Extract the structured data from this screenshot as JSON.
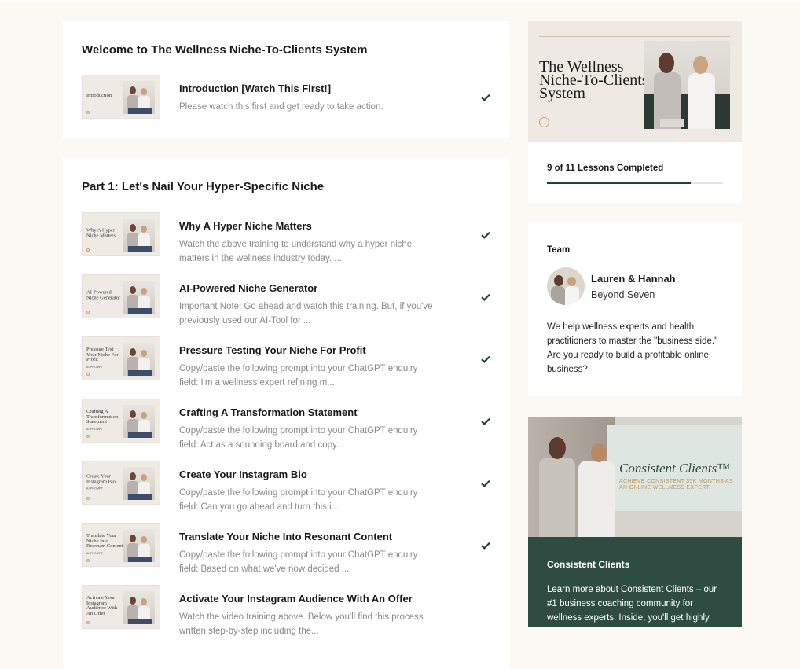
{
  "sections": [
    {
      "title": "Welcome to The Wellness Niche-To-Clients System",
      "lessons": [
        {
          "title": "Introduction [Watch This First!]",
          "description": "Please watch this first and get ready to take action.",
          "thumb_title": "Introduction",
          "thumb_sub": "",
          "completed": true
        }
      ]
    },
    {
      "title": "Part 1: Let's Nail Your Hyper-Specific Niche",
      "lessons": [
        {
          "title": "Why A Hyper Niche Matters",
          "description": "Watch the above training to understand why a hyper niche matters in the wellness industry today. ...",
          "thumb_title": "Why A Hyper Niche Matters",
          "thumb_sub": "",
          "completed": true
        },
        {
          "title": "AI-Powered Niche Generator",
          "description": "Important Note: Go ahead and watch this training. But, if you've previously used our AI-Tool for ...",
          "thumb_title": "AI-Powered Niche Generator",
          "thumb_sub": "",
          "completed": true
        },
        {
          "title": "Pressure Testing Your Niche For Profit",
          "description": "Copy/paste the following prompt into your ChatGPT enquiry field: I'm a wellness expert refining m...",
          "thumb_title": "Pressure Test Your Niche For Profit",
          "thumb_sub": "AI PROMPT",
          "completed": true
        },
        {
          "title": "Crafting A Transformation Statement",
          "description": "Copy/paste the following prompt into your ChatGPT enquiry field: Act as a sounding board and copy...",
          "thumb_title": "Crafting A Transformation Statement",
          "thumb_sub": "AI PROMPT",
          "completed": true
        },
        {
          "title": "Create Your Instagram Bio",
          "description": "Copy/paste the following prompt into your ChatGPT enquiry field: Can you go ahead and turn this i...",
          "thumb_title": "Create Your Instagram Bio",
          "thumb_sub": "AI PROMPT",
          "completed": true
        },
        {
          "title": "Translate Your Niche Into Resonant Content",
          "description": "Copy/paste the following prompt into your ChatGPT enquiry field: Based on what we've now decided ...",
          "thumb_title": "Translate Your Niche Into Resonant Content",
          "thumb_sub": "AI PROMPT",
          "completed": true
        },
        {
          "title": "Activate Your Instagram Audience With An Offer",
          "description": "Watch the video training above. Below you'll find this process written step-by-step including the...",
          "thumb_title": "Activate Your Instagram Audience With An Offer",
          "thumb_sub": "",
          "completed": false
        }
      ]
    }
  ],
  "sidebar": {
    "banner_title": "The Wellness Niche-To-Clients System",
    "progress_text": "9 of 11 Lessons Completed",
    "progress_completed": 9,
    "progress_total": 11,
    "team_label": "Team",
    "team_name": "Lauren & Hannah",
    "team_company": "Beyond Seven",
    "team_description": "We help wellness experts and health practitioners to master the \"business side.\" Are you ready to build a profitable online business?",
    "promo_script": "Consistent Clients™",
    "promo_tagline": "ACHIEVE CONSISTENT $5K MONTHS AS AN ONLINE WELLNESS EXPERT",
    "promo_title": "Consistent Clients",
    "promo_text": "Learn more about Consistent Clients – our #1 business coaching community for wellness experts. Inside, you'll get highly"
  },
  "colors": {
    "accent": "#1e4235",
    "promo_bg": "#2f4c43",
    "check": "#1e4235"
  },
  "icons": {
    "check": "check-icon",
    "arrow": "arrow-right-circle-icon"
  }
}
